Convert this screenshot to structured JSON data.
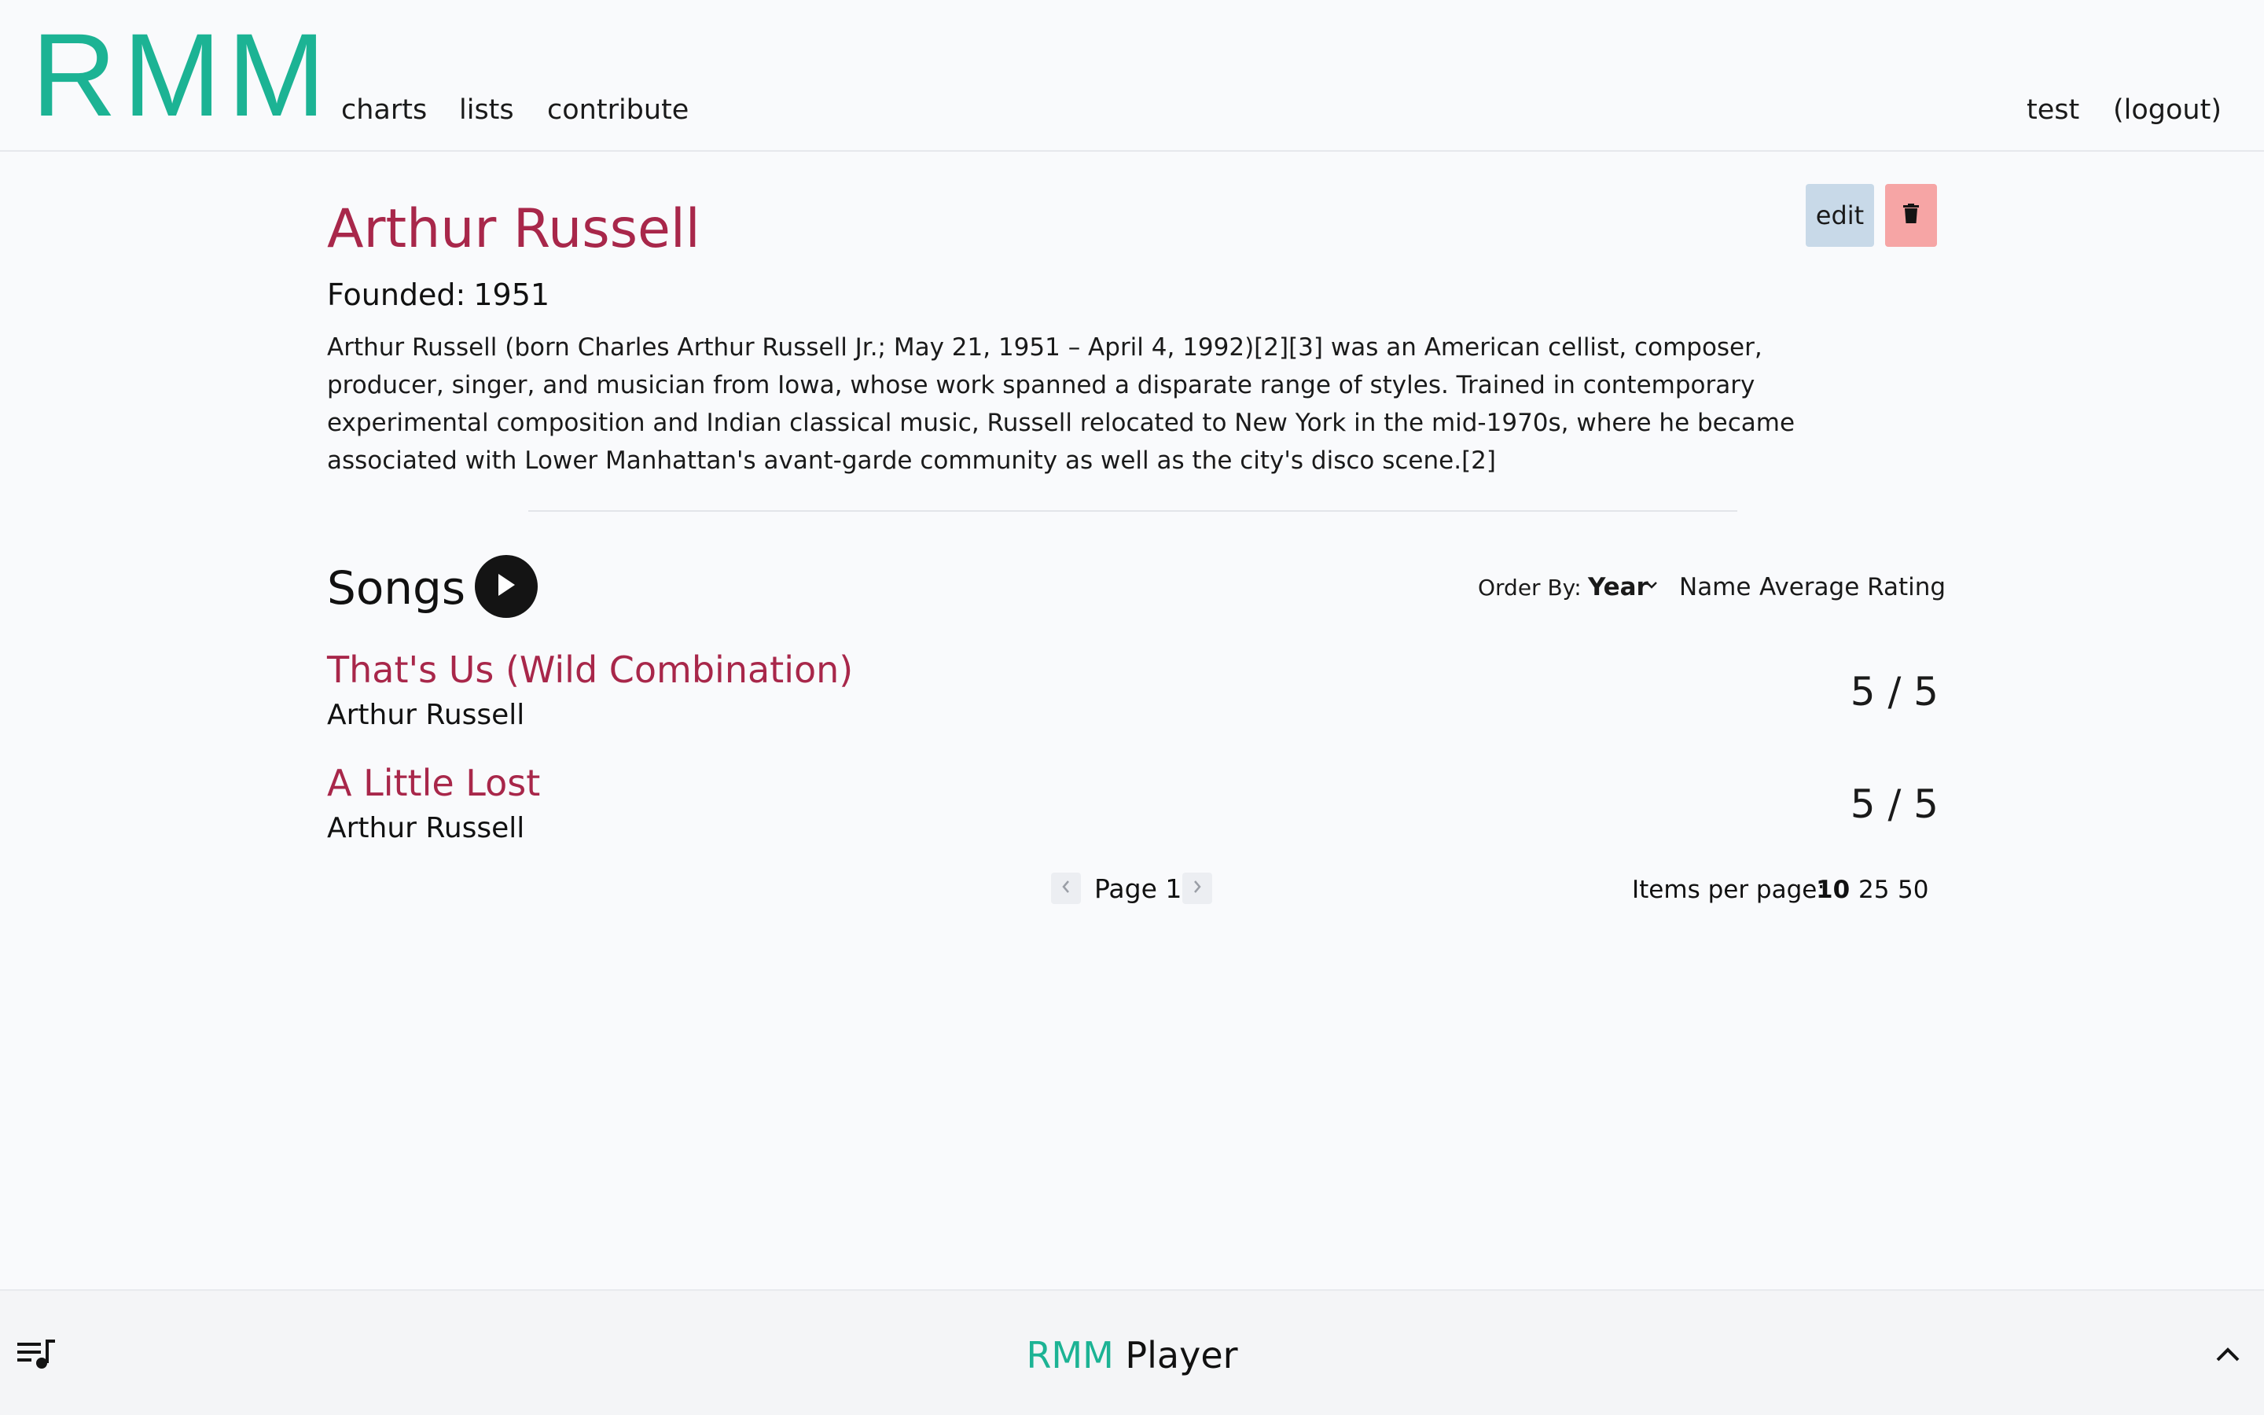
{
  "header": {
    "logo": "RMM",
    "nav": {
      "charts": "charts",
      "lists": "lists",
      "contribute": "contribute"
    },
    "user": "test",
    "logout": "(logout)"
  },
  "artist": {
    "name": "Arthur Russell",
    "founded_label": "Founded:",
    "founded_year": "1951",
    "bio": "Arthur Russell (born Charles Arthur Russell Jr.; May 21, 1951 – April 4, 1992)[2][3] was an American cellist, composer, producer, singer, and musician from Iowa, whose work spanned a disparate range of styles. Trained in contemporary experimental composition and Indian classical music, Russell relocated to New York in the mid-1970s, where he became associated with Lower Manhattan's avant-garde community as well as the city's disco scene.[2]",
    "edit_label": "edit",
    "delete_icon": "trash-icon"
  },
  "songs_section": {
    "heading": "Songs",
    "order_by_label": "Order By:",
    "order_options": [
      "Year",
      "Name",
      "Average Rating"
    ],
    "order_selected": "Year",
    "songs": [
      {
        "title": "That's Us (Wild Combination)",
        "artist": "Arthur Russell",
        "rating": "5 / 5"
      },
      {
        "title": "A Little Lost",
        "artist": "Arthur Russell",
        "rating": "5 / 5"
      }
    ],
    "pagination": {
      "page_label": "Page 1",
      "items_per_page_label": "Items per page:",
      "items_per_page_options": [
        "10",
        "25",
        "50"
      ],
      "items_per_page_selected": "10"
    }
  },
  "player": {
    "brand": "RMM",
    "label": "Player"
  },
  "colors": {
    "brand": "#1cb394",
    "title": "#a8274a",
    "edit_bg": "#c8d9e8",
    "delete_bg": "#f6a5a5"
  }
}
